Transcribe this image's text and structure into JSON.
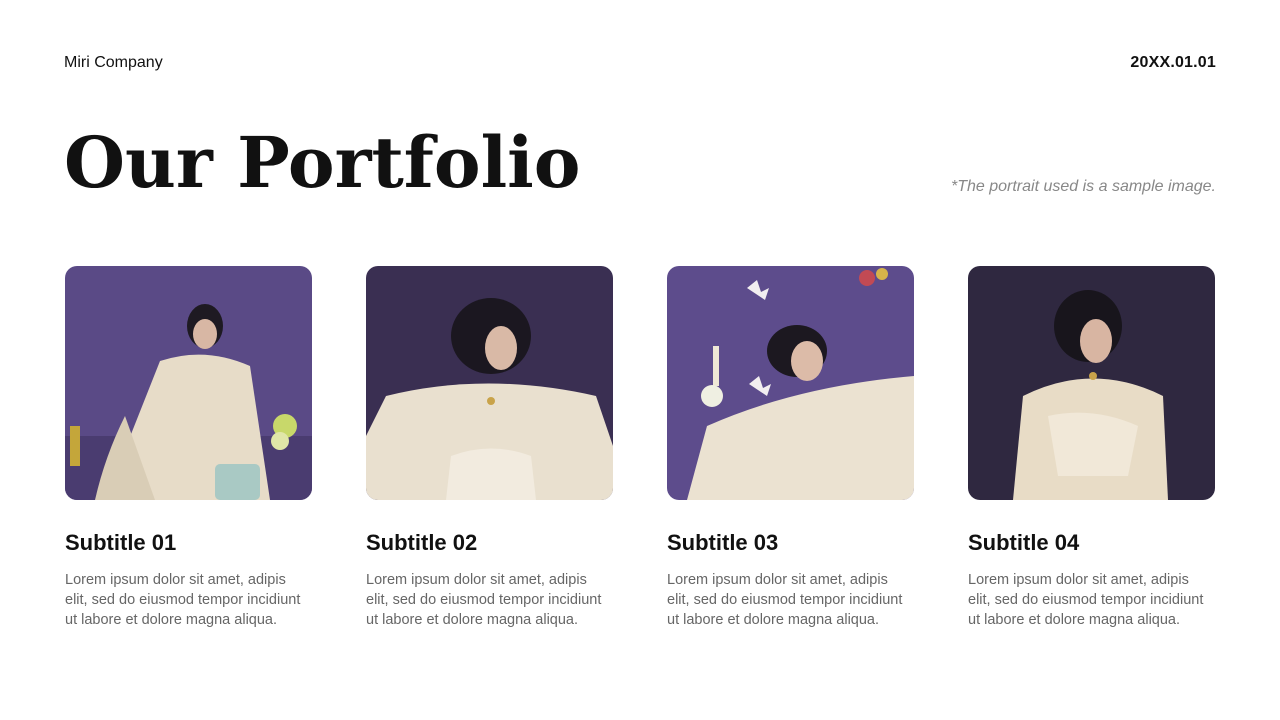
{
  "header": {
    "company": "Miri Company",
    "date": "20XX.01.01"
  },
  "title": "Our Portfolio",
  "note": "*The portrait used is a sample image.",
  "cards": [
    {
      "subtitle": "Subtitle 01",
      "body": "Lorem ipsum dolor sit amet, adipis elit, sed do eiusmod tempor incidiunt ut labore et dolore magna aliqua."
    },
    {
      "subtitle": "Subtitle 02",
      "body": "Lorem ipsum dolor sit amet, adipis elit, sed do eiusmod tempor incidiunt ut labore et dolore magna aliqua."
    },
    {
      "subtitle": "Subtitle 03",
      "body": "Lorem ipsum dolor sit amet, adipis elit, sed do eiusmod tempor incidiunt ut labore et dolore magna aliqua."
    },
    {
      "subtitle": "Subtitle 04",
      "body": "Lorem ipsum dolor sit amet, adipis elit, sed do eiusmod tempor incidiunt ut labore et dolore magna aliqua."
    }
  ],
  "colors": {
    "background": "#ffffff",
    "backdrop_purple": "#5b4a8a",
    "dress_cream": "#ece3d3",
    "text_primary": "#111111",
    "text_muted": "#666666"
  }
}
